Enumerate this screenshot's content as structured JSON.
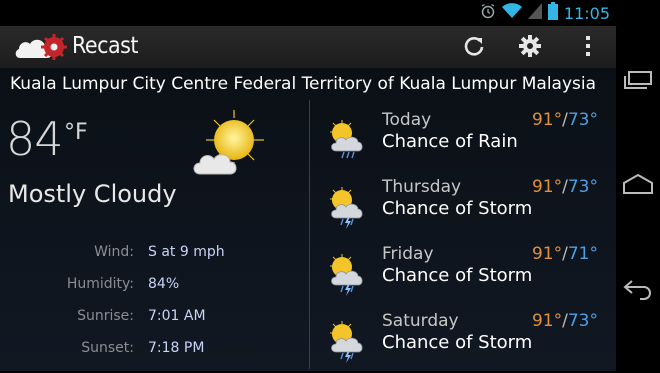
{
  "status_bar": {
    "time": "11:05"
  },
  "action_bar": {
    "title": "Recast",
    "actions": [
      "refresh-icon",
      "settings-icon",
      "overflow-menu-icon"
    ]
  },
  "location": "Kuala Lumpur City Centre Federal Territory of Kuala Lumpur Malaysia",
  "current": {
    "temp": "84",
    "unit": "°F",
    "condition": "Mostly Cloudy",
    "icon": "partly-cloudy-icon",
    "details": [
      {
        "label": "Wind:",
        "value": "S at 9 mph"
      },
      {
        "label": "Humidity:",
        "value": "84%"
      },
      {
        "label": "Sunrise:",
        "value": "7:01 AM"
      },
      {
        "label": "Sunset:",
        "value": "7:18 PM"
      }
    ]
  },
  "forecast": [
    {
      "day": "Today",
      "condition": "Chance of Rain",
      "high": "91°",
      "low": "73°",
      "icon": "rain-icon"
    },
    {
      "day": "Thursday",
      "condition": "Chance of Storm",
      "high": "91°",
      "low": "73°",
      "icon": "storm-icon"
    },
    {
      "day": "Friday",
      "condition": "Chance of Storm",
      "high": "91°",
      "low": "71°",
      "icon": "storm-icon"
    },
    {
      "day": "Saturday",
      "condition": "Chance of Storm",
      "high": "91°",
      "low": "73°",
      "icon": "storm-icon"
    }
  ],
  "colors": {
    "accent": "#33b5e5",
    "high": "#e0913a",
    "low": "#4f9fe3"
  }
}
